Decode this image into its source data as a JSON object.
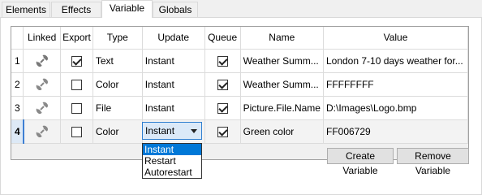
{
  "tabs": [
    "Elements",
    "Effects",
    "Variable",
    "Globals"
  ],
  "active_tab": "Variable",
  "table": {
    "columns": [
      "",
      "Linked",
      "Export",
      "Type",
      "Update",
      "Queue",
      "Name",
      "Value"
    ],
    "rows": [
      {
        "num": "1",
        "linked": true,
        "export": true,
        "type": "Text",
        "update": "Instant",
        "queue": true,
        "name": "Weather Summ...",
        "value": "London 7-10 days weather for..."
      },
      {
        "num": "2",
        "linked": false,
        "export": false,
        "type": "Color",
        "update": "Instant",
        "queue": true,
        "name": "Weather Summ...",
        "value": "FFFFFFFF"
      },
      {
        "num": "3",
        "linked": false,
        "export": false,
        "type": "File",
        "update": "Instant",
        "queue": true,
        "name": "Picture.File.Name",
        "value": "D:\\Images\\Logo.bmp"
      },
      {
        "num": "4",
        "linked": false,
        "export": false,
        "type": "Color",
        "update": "Instant",
        "queue": true,
        "name": "Green color",
        "value": "FF006729"
      }
    ]
  },
  "update_dropdown": {
    "selected": "Instant",
    "options": [
      "Instant",
      "Restart",
      "Autorestart"
    ]
  },
  "buttons": {
    "create": "Create Variable",
    "remove": "Remove Variable"
  },
  "colors": {
    "selection": "#0078d7",
    "combo_bg": "#dbe9f8",
    "current_row_marker": "#3d7fd3"
  }
}
